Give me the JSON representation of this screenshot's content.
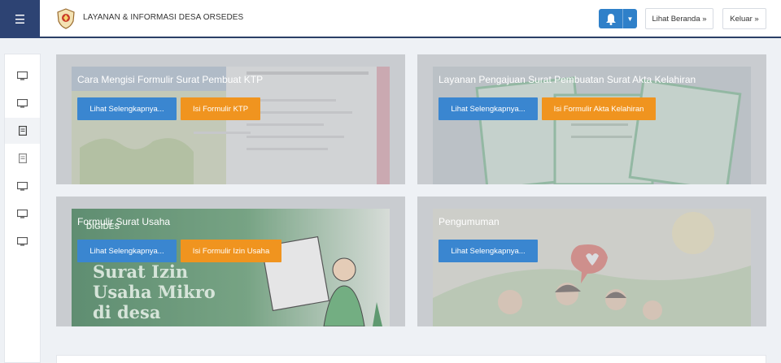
{
  "header": {
    "menu_icon": "hamburger-icon",
    "logo_icon": "village-emblem-icon",
    "title": "LAYANAN & INFORMASI DESA ORSEDES",
    "bell_icon": "bell-icon",
    "caret_icon": "caret-down-icon",
    "home_label": "Lihat Beranda »",
    "logout_label": "Keluar »"
  },
  "sidebar": {
    "items": [
      {
        "icon": "monitor-icon"
      },
      {
        "icon": "monitor-icon"
      },
      {
        "icon": "document-icon"
      },
      {
        "icon": "document-icon"
      },
      {
        "icon": "monitor-icon"
      },
      {
        "icon": "monitor-icon"
      },
      {
        "icon": "monitor-icon"
      }
    ]
  },
  "cards": [
    {
      "title": "Cara Mengisi Formulir Surat Pembuat KTP",
      "primary": "Lihat Selengkapnya...",
      "secondary": "Isi Formulir KTP"
    },
    {
      "title": "Layanan Pengajuan Surat Pembuatan Surat Akta Kelahiran",
      "primary": "Lihat Selengkapnya...",
      "secondary": "Isi Formulir Akta Kelahiran"
    },
    {
      "title": "Formulir Surat Usaha",
      "primary": "Lihat Selengkapnya...",
      "secondary": "Isi Formulir Izin Usaha",
      "image_text": [
        "Surat Izin",
        "Usaha Mikro",
        "di desa",
        "DIGIDES"
      ]
    },
    {
      "title": "Pengumuman",
      "primary": "Lihat Selengkapnya..."
    }
  ],
  "colors": {
    "nav_dark": "#2d4373",
    "primary_blue": "#3a86d0",
    "accent_orange": "#f0941f"
  }
}
